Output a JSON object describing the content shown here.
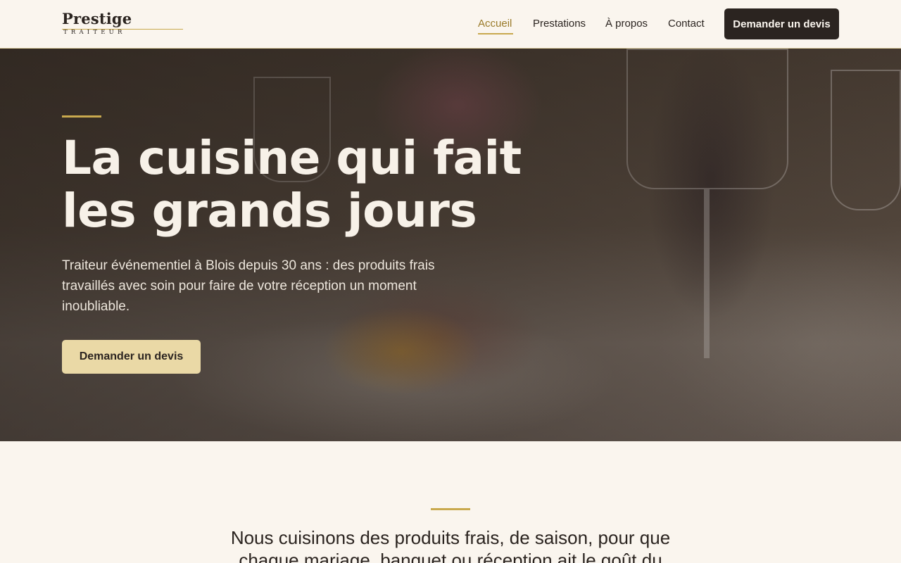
{
  "header": {
    "logo": {
      "name": "Prestige",
      "subtitle": "TRAITEUR"
    },
    "nav": [
      {
        "label": "Accueil",
        "active": true
      },
      {
        "label": "Prestations",
        "active": false
      },
      {
        "label": "À propos",
        "active": false
      },
      {
        "label": "Contact",
        "active": false
      }
    ],
    "cta_label": "Demander un devis"
  },
  "hero": {
    "title_line1": "La cuisine qui fait",
    "title_line2": "les grands jours",
    "text": "Traiteur événementiel à Blois depuis 30 ans : des produits frais travaillés avec soin pour faire de votre réception un moment inoubliable.",
    "cta_label": "Demander un devis"
  },
  "intro": {
    "text": "Nous cuisinons des produits frais, de saison, pour que chaque mariage, banquet ou réception ait le goût du"
  },
  "colors": {
    "background": "#faf5ee",
    "dark": "#2b2420",
    "gold": "#c9a94e",
    "hero_button": "#ead9a6"
  }
}
